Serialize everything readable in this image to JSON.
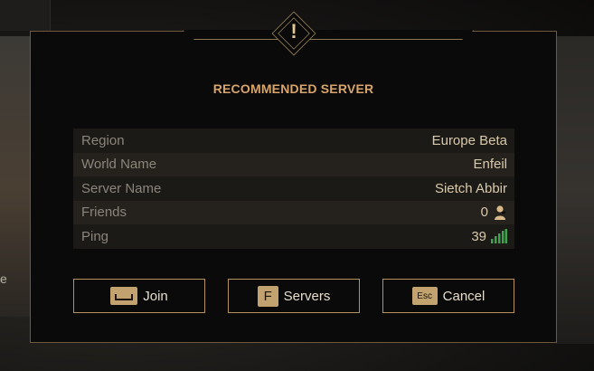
{
  "background": {
    "edge_text": "e"
  },
  "dialog": {
    "title": "RECOMMENDED SERVER",
    "emblem_icon": "exclamation-icon",
    "emblem_symbol": "!",
    "rows": [
      {
        "label": "Region",
        "value": "Europe Beta"
      },
      {
        "label": "World Name",
        "value": "Enfeil"
      },
      {
        "label": "Server Name",
        "value": "Sietch Abbir"
      },
      {
        "label": "Friends",
        "value": "0",
        "icon": "person-icon"
      },
      {
        "label": "Ping",
        "value": "39",
        "icon": "signal-bars-icon",
        "signal_color": "#3fa34d"
      }
    ],
    "buttons": [
      {
        "key": "space-key-icon",
        "key_label": "",
        "label": "Join"
      },
      {
        "key": "f-key-icon",
        "key_label": "F",
        "label": "Servers"
      },
      {
        "key": "esc-key-icon",
        "key_label": "Esc",
        "label": "Cancel"
      }
    ]
  },
  "colors": {
    "accent_gold": "#d8a56b",
    "border_gold": "#b6925c",
    "ping_green": "#3fa34d"
  }
}
